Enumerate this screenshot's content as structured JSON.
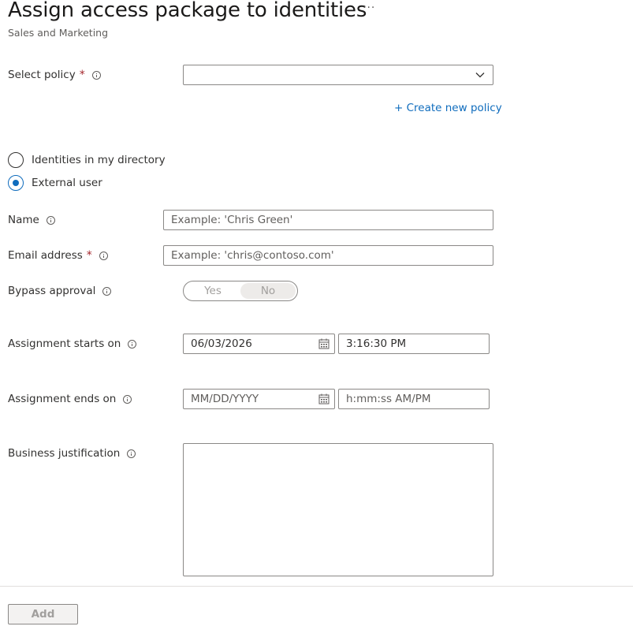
{
  "header": {
    "title": "Assign access package to identities",
    "more_label": "···",
    "subtitle": "Sales and Marketing"
  },
  "policy": {
    "label": "Select policy",
    "required_mark": "*",
    "value": "",
    "create_link": "+ Create new policy"
  },
  "identity_type": {
    "options": [
      {
        "label": "Identities in my directory",
        "checked": false
      },
      {
        "label": "External user",
        "checked": true
      }
    ]
  },
  "name": {
    "label": "Name",
    "placeholder": "Example: 'Chris Green'"
  },
  "email": {
    "label": "Email address",
    "required_mark": "*",
    "placeholder": "Example: 'chris@contoso.com'"
  },
  "bypass": {
    "label": "Bypass approval",
    "yes": "Yes",
    "no": "No",
    "selected": "No"
  },
  "starts": {
    "label": "Assignment starts on",
    "date": "06/03/2026",
    "time": "3:16:30 PM"
  },
  "ends": {
    "label": "Assignment ends on",
    "date_placeholder": "MM/DD/YYYY",
    "time_placeholder": "h:mm:ss AM/PM"
  },
  "justification": {
    "label": "Business justification",
    "value": ""
  },
  "footer": {
    "add_label": "Add"
  },
  "icons": [
    "more-icon",
    "info-icon",
    "chevron-down-icon",
    "calendar-icon"
  ],
  "colors": {
    "accent": "#0f6cbd",
    "required": "#a4262c",
    "border": "#8a8886"
  }
}
